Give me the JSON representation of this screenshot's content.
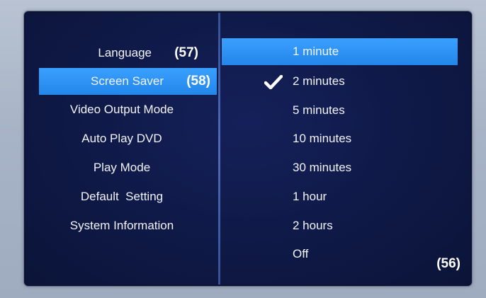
{
  "left_menu": {
    "items": [
      {
        "label": "Language",
        "badge": "(57)"
      },
      {
        "label": "Screen Saver",
        "badge": "(58)"
      },
      {
        "label": "Video Output Mode"
      },
      {
        "label": "Auto Play DVD"
      },
      {
        "label": "Play Mode"
      },
      {
        "label": "Default  Setting"
      },
      {
        "label": "System Information"
      }
    ],
    "selected_index": 1
  },
  "right_menu": {
    "options": [
      {
        "label": "1 minute"
      },
      {
        "label": "2 minutes",
        "checked": true
      },
      {
        "label": "5 minutes"
      },
      {
        "label": "10 minutes"
      },
      {
        "label": "30 minutes"
      },
      {
        "label": "1 hour"
      },
      {
        "label": "2 hours"
      },
      {
        "label": "Off"
      }
    ],
    "highlighted_index": 0,
    "checked_index": 1,
    "corner_badge": "(56)",
    "check_icon": "checkmark-icon"
  },
  "colors": {
    "background": "#101a44",
    "highlight": "#2a8ff0",
    "divider": "#4a68b8",
    "text": "#f2f4fa"
  }
}
